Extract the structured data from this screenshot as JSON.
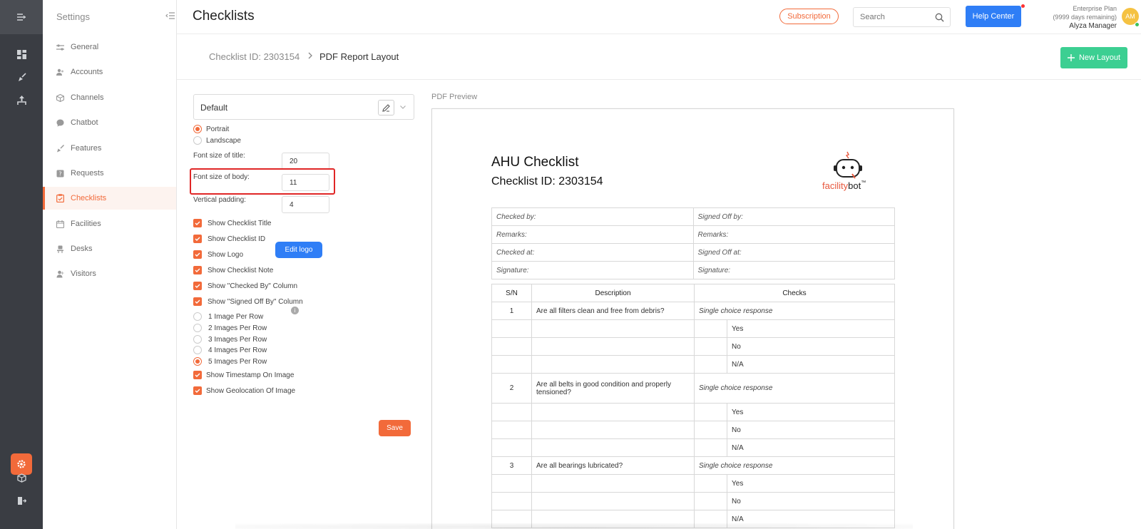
{
  "app": {
    "settings_title": "Settings",
    "page_title": "Checklists"
  },
  "header": {
    "subscription_label": "Subscription",
    "search_placeholder": "Search",
    "help_label": "Help Center",
    "plan_name": "Enterprise Plan",
    "plan_days": "(9999 days remaining)",
    "user_name": "Alyza Manager",
    "avatar_initials": "AM"
  },
  "sidebar": {
    "items": [
      {
        "label": "General",
        "icon": "sliders-icon"
      },
      {
        "label": "Accounts",
        "icon": "users-icon"
      },
      {
        "label": "Channels",
        "icon": "cube-icon"
      },
      {
        "label": "Chatbot",
        "icon": "chat-bubble-icon"
      },
      {
        "label": "Features",
        "icon": "rocket-icon"
      },
      {
        "label": "Requests",
        "icon": "question-box-icon"
      },
      {
        "label": "Checklists",
        "icon": "clipboard-check-icon"
      },
      {
        "label": "Facilities",
        "icon": "calendar-icon"
      },
      {
        "label": "Desks",
        "icon": "chair-icon"
      },
      {
        "label": "Visitors",
        "icon": "visitor-icon"
      }
    ],
    "active": "Checklists"
  },
  "breadcrumb": {
    "parent": "Checklist ID: 2303154",
    "current": "PDF Report Layout"
  },
  "toolbar": {
    "new_layout_label": "New Layout"
  },
  "form": {
    "layout_select_value": "Default",
    "orientation": {
      "options": [
        "Portrait",
        "Landscape"
      ],
      "selected": "Portrait"
    },
    "font_size_title_label": "Font size of title:",
    "font_size_title_value": "20",
    "font_size_body_label": "Font size of body:",
    "font_size_body_value": "11",
    "vertical_padding_label": "Vertical padding:",
    "vertical_padding_value": "4",
    "checkboxes": [
      {
        "label": "Show Checklist Title",
        "checked": true
      },
      {
        "label": "Show Checklist ID",
        "checked": true
      },
      {
        "label": "Show Logo",
        "checked": true
      },
      {
        "label": "Show Checklist Note",
        "checked": true
      },
      {
        "label": "Show \"Checked By\" Column",
        "checked": true
      },
      {
        "label": "Show \"Signed Off By\" Column",
        "checked": true
      }
    ],
    "edit_logo_label": "Edit logo",
    "images_per_row": {
      "options": [
        "1 Image Per Row",
        "2 Images Per Row",
        "3 Images Per Row",
        "4 Images Per Row",
        "5 Images Per Row"
      ],
      "selected": "5 Images Per Row"
    },
    "image_checkboxes": [
      {
        "label": "Show Timestamp On Image",
        "checked": true
      },
      {
        "label": "Show Geolocation Of Image",
        "checked": true
      }
    ],
    "info_glyph": "i",
    "save_label": "Save"
  },
  "preview": {
    "label": "PDF Preview",
    "title": "AHU Checklist",
    "checklist_id": "Checklist ID: 2303154",
    "logo_brand_a": "facility",
    "logo_brand_b": "bot",
    "logo_tm": "™",
    "meta": [
      [
        "Checked by:",
        "Signed Off by:"
      ],
      [
        "Remarks:",
        "Remarks:"
      ],
      [
        "Checked at:",
        "Signed Off at:"
      ],
      [
        "Signature:",
        "Signature:"
      ]
    ],
    "table_headers": [
      "S/N",
      "Description",
      "Checks"
    ],
    "items": [
      {
        "sn": "1",
        "description": "Are all filters clean and free from debris?",
        "response_type": "Single choice response",
        "options": [
          "Yes",
          "No",
          "N/A"
        ]
      },
      {
        "sn": "2",
        "description": "Are all belts in good condition and properly tensioned?",
        "response_type": "Single choice response",
        "options": [
          "Yes",
          "No",
          "N/A"
        ]
      },
      {
        "sn": "3",
        "description": "Are all bearings lubricated?",
        "response_type": "Single choice response",
        "options": [
          "Yes",
          "No",
          "N/A"
        ]
      }
    ]
  },
  "colors": {
    "accent": "#f26a3a",
    "primary_blue": "#2f7ef6",
    "new_layout_green": "#3ccf92",
    "rail_bg": "#3a3d43",
    "highlight_red": "#e02626"
  }
}
